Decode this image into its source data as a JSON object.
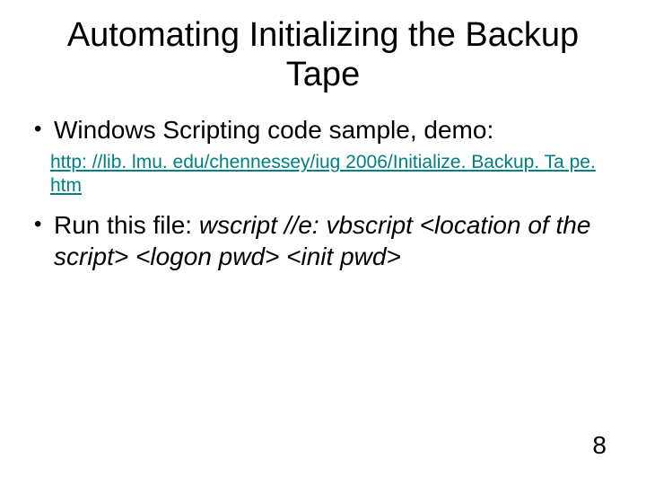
{
  "title": "Automating Initializing the Backup Tape",
  "bullets": {
    "b1_text": "Windows Scripting code sample, demo:",
    "b1_link": "http: //lib. lmu. edu/chennessey/iug 2006/Initialize. Backup. Ta pe. htm",
    "b2_prefix": "Run this file: ",
    "b2_italic": "wscript //e: vbscript <location of the script> <logon pwd> <init pwd>"
  },
  "page_number": "8"
}
